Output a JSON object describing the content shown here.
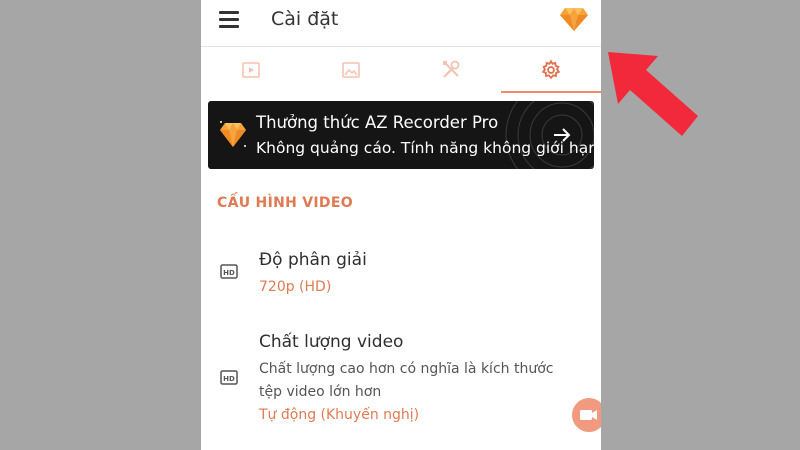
{
  "appbar": {
    "title": "Cài đặt"
  },
  "icons": {
    "menu": "hamburger-menu-icon",
    "premium": "diamond-icon",
    "tabs": [
      "video-icon",
      "image-icon",
      "tools-icon",
      "gear-icon"
    ],
    "banner_arrow": "arrow-right-icon",
    "row": "hd-icon",
    "fab": "camera-record-icon",
    "pointer": "red-arrow-icon"
  },
  "tabs": {
    "selected_index": 3
  },
  "banner": {
    "title": "Thưởng thức AZ Recorder Pro",
    "subtitle": "Không quảng cáo. Tính năng không giới hạn"
  },
  "section": {
    "title": "CẤU HÌNH VIDEO"
  },
  "settings": [
    {
      "title": "Độ phân giải",
      "value": "720p (HD)",
      "desc": []
    },
    {
      "title": "Chất lượng video",
      "desc": [
        "Chất lượng cao hơn có nghĩa là kích thước",
        "tệp video lớn hơn"
      ],
      "value": "Tự động (Khuyến nghị)"
    }
  ],
  "colors": {
    "accent": "#e07a52",
    "tab_active": "#ef8a6c",
    "banner_bg": "#151515",
    "pointer_arrow": "#f2293a",
    "backdrop": "#a6a6a6"
  }
}
